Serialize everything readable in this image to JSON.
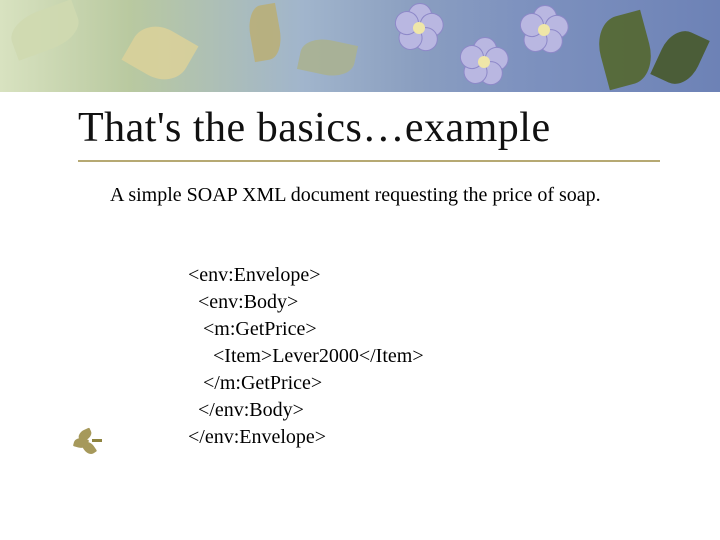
{
  "title": "That's the basics…example",
  "description": "A simple SOAP XML document requesting the price of soap.",
  "code_lines": [
    "<env:Envelope>",
    "  <env:Body>",
    "   <m:GetPrice>",
    "     <Item>Lever2000</Item>",
    "   </m:GetPrice>",
    "  </env:Body>",
    "</env:Envelope>"
  ],
  "colors": {
    "underline": "#b6a973",
    "title": "#111"
  }
}
